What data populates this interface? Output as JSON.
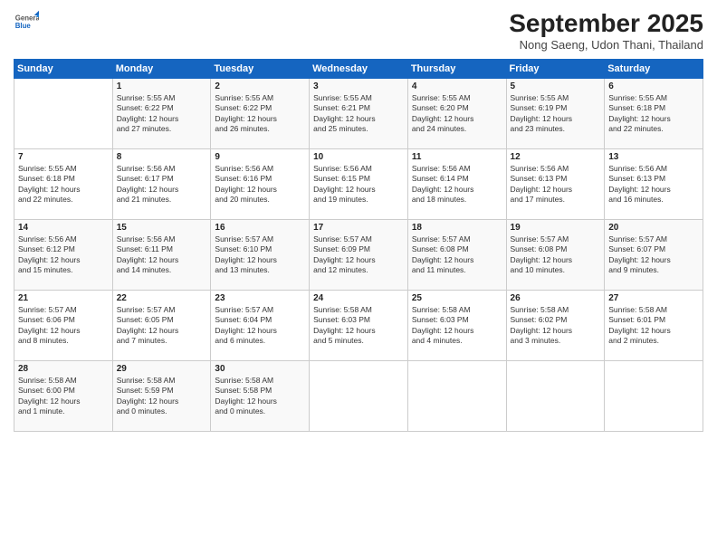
{
  "logo": {
    "general": "General",
    "blue": "Blue"
  },
  "header": {
    "month": "September 2025",
    "location": "Nong Saeng, Udon Thani, Thailand"
  },
  "weekdays": [
    "Sunday",
    "Monday",
    "Tuesday",
    "Wednesday",
    "Thursday",
    "Friday",
    "Saturday"
  ],
  "weeks": [
    [
      {
        "day": "",
        "content": ""
      },
      {
        "day": "1",
        "content": "Sunrise: 5:55 AM\nSunset: 6:22 PM\nDaylight: 12 hours\nand 27 minutes."
      },
      {
        "day": "2",
        "content": "Sunrise: 5:55 AM\nSunset: 6:22 PM\nDaylight: 12 hours\nand 26 minutes."
      },
      {
        "day": "3",
        "content": "Sunrise: 5:55 AM\nSunset: 6:21 PM\nDaylight: 12 hours\nand 25 minutes."
      },
      {
        "day": "4",
        "content": "Sunrise: 5:55 AM\nSunset: 6:20 PM\nDaylight: 12 hours\nand 24 minutes."
      },
      {
        "day": "5",
        "content": "Sunrise: 5:55 AM\nSunset: 6:19 PM\nDaylight: 12 hours\nand 23 minutes."
      },
      {
        "day": "6",
        "content": "Sunrise: 5:55 AM\nSunset: 6:18 PM\nDaylight: 12 hours\nand 22 minutes."
      }
    ],
    [
      {
        "day": "7",
        "content": "Sunrise: 5:55 AM\nSunset: 6:18 PM\nDaylight: 12 hours\nand 22 minutes."
      },
      {
        "day": "8",
        "content": "Sunrise: 5:56 AM\nSunset: 6:17 PM\nDaylight: 12 hours\nand 21 minutes."
      },
      {
        "day": "9",
        "content": "Sunrise: 5:56 AM\nSunset: 6:16 PM\nDaylight: 12 hours\nand 20 minutes."
      },
      {
        "day": "10",
        "content": "Sunrise: 5:56 AM\nSunset: 6:15 PM\nDaylight: 12 hours\nand 19 minutes."
      },
      {
        "day": "11",
        "content": "Sunrise: 5:56 AM\nSunset: 6:14 PM\nDaylight: 12 hours\nand 18 minutes."
      },
      {
        "day": "12",
        "content": "Sunrise: 5:56 AM\nSunset: 6:13 PM\nDaylight: 12 hours\nand 17 minutes."
      },
      {
        "day": "13",
        "content": "Sunrise: 5:56 AM\nSunset: 6:13 PM\nDaylight: 12 hours\nand 16 minutes."
      }
    ],
    [
      {
        "day": "14",
        "content": "Sunrise: 5:56 AM\nSunset: 6:12 PM\nDaylight: 12 hours\nand 15 minutes."
      },
      {
        "day": "15",
        "content": "Sunrise: 5:56 AM\nSunset: 6:11 PM\nDaylight: 12 hours\nand 14 minutes."
      },
      {
        "day": "16",
        "content": "Sunrise: 5:57 AM\nSunset: 6:10 PM\nDaylight: 12 hours\nand 13 minutes."
      },
      {
        "day": "17",
        "content": "Sunrise: 5:57 AM\nSunset: 6:09 PM\nDaylight: 12 hours\nand 12 minutes."
      },
      {
        "day": "18",
        "content": "Sunrise: 5:57 AM\nSunset: 6:08 PM\nDaylight: 12 hours\nand 11 minutes."
      },
      {
        "day": "19",
        "content": "Sunrise: 5:57 AM\nSunset: 6:08 PM\nDaylight: 12 hours\nand 10 minutes."
      },
      {
        "day": "20",
        "content": "Sunrise: 5:57 AM\nSunset: 6:07 PM\nDaylight: 12 hours\nand 9 minutes."
      }
    ],
    [
      {
        "day": "21",
        "content": "Sunrise: 5:57 AM\nSunset: 6:06 PM\nDaylight: 12 hours\nand 8 minutes."
      },
      {
        "day": "22",
        "content": "Sunrise: 5:57 AM\nSunset: 6:05 PM\nDaylight: 12 hours\nand 7 minutes."
      },
      {
        "day": "23",
        "content": "Sunrise: 5:57 AM\nSunset: 6:04 PM\nDaylight: 12 hours\nand 6 minutes."
      },
      {
        "day": "24",
        "content": "Sunrise: 5:58 AM\nSunset: 6:03 PM\nDaylight: 12 hours\nand 5 minutes."
      },
      {
        "day": "25",
        "content": "Sunrise: 5:58 AM\nSunset: 6:03 PM\nDaylight: 12 hours\nand 4 minutes."
      },
      {
        "day": "26",
        "content": "Sunrise: 5:58 AM\nSunset: 6:02 PM\nDaylight: 12 hours\nand 3 minutes."
      },
      {
        "day": "27",
        "content": "Sunrise: 5:58 AM\nSunset: 6:01 PM\nDaylight: 12 hours\nand 2 minutes."
      }
    ],
    [
      {
        "day": "28",
        "content": "Sunrise: 5:58 AM\nSunset: 6:00 PM\nDaylight: 12 hours\nand 1 minute."
      },
      {
        "day": "29",
        "content": "Sunrise: 5:58 AM\nSunset: 5:59 PM\nDaylight: 12 hours\nand 0 minutes."
      },
      {
        "day": "30",
        "content": "Sunrise: 5:58 AM\nSunset: 5:58 PM\nDaylight: 12 hours\nand 0 minutes."
      },
      {
        "day": "",
        "content": ""
      },
      {
        "day": "",
        "content": ""
      },
      {
        "day": "",
        "content": ""
      },
      {
        "day": "",
        "content": ""
      }
    ]
  ]
}
